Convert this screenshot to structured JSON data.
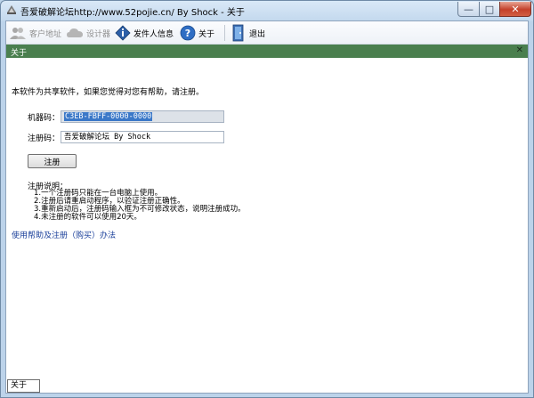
{
  "window": {
    "title": "吾爱破解论坛http://www.52pojie.cn/ By Shock - 关于",
    "controls": {
      "minimize": "—",
      "maximize": "□",
      "close": "✕"
    }
  },
  "toolbar": {
    "items": [
      {
        "label": "客户地址",
        "icon": "people-icon",
        "enabled": false
      },
      {
        "label": "设计器",
        "icon": "cloud-icon",
        "enabled": false
      },
      {
        "label": "发件人信息",
        "icon": "info-icon",
        "enabled": true
      },
      {
        "label": "关于",
        "icon": "question-icon",
        "enabled": true
      },
      {
        "label": "退出",
        "icon": "exit-door-icon",
        "enabled": true
      }
    ]
  },
  "dialog": {
    "title": "关于",
    "close": "✕",
    "intro": "本软件为共享软件，如果您觉得对您有帮助，请注册。",
    "machine_label": "机器码：",
    "machine_code": "C3EB-FBFF-0000-0000",
    "reg_label": "注册码：",
    "reg_code": "吾爱破解论坛 By Shock",
    "register_button": "注册",
    "notes_title": "注册说明：",
    "notes": [
      "1.一个注册码只能在一台电脑上使用。",
      "2.注册后请重启动程序，以验证注册正确性。",
      "3.重新启动后，注册码输入框为不可修改状态，说明注册成功。",
      "4.未注册的软件可以使用20天。"
    ],
    "help_link": "使用帮助及注册（购买）办法"
  },
  "status_bar": {
    "tab": "关于"
  }
}
